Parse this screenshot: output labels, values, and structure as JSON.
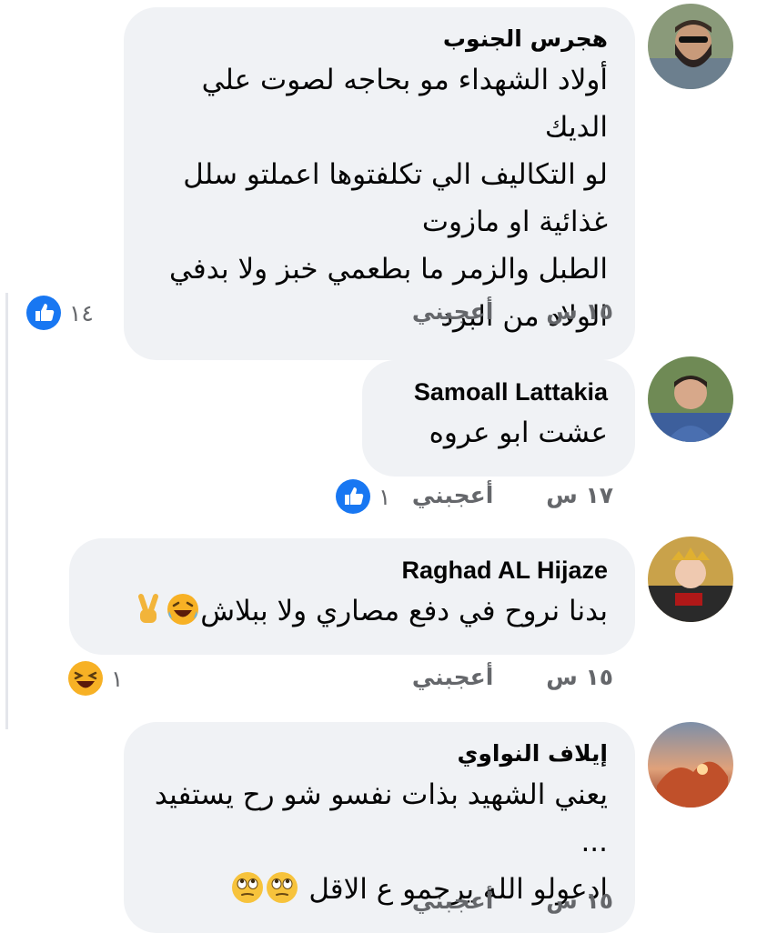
{
  "comments": [
    {
      "author": "هجرس الجنوب",
      "text": "أولاد الشهداء مو بحاجه لصوت علي الديك\nلو التكاليف الي تكلفتوها اعملتو سلل غذائية او مازوت\nالطبل والزمر ما بطعمي خبز ولا بدفي الولاد من البرد",
      "time": "١٥ س",
      "like": "أعجبني",
      "reaction_icon": "like-icon",
      "reaction_count": "١٤"
    },
    {
      "author": "Samoall Lattakia",
      "text": "عشت ابو عروه",
      "time": "١٧ س",
      "like": "أعجبني",
      "reaction_icon": "like-icon",
      "reaction_count": "١"
    },
    {
      "author": "Raghad AL Hijaze",
      "text": "بدنا نروح في دفع مصاري ولا ببلاش",
      "text_emojis": [
        "laughing-tears-emoji",
        "victory-hand-emoji"
      ],
      "time": "١٥ س",
      "like": "أعجبني",
      "reaction_icon": "haha-icon",
      "reaction_count": "١"
    },
    {
      "author": "إيلاف النواوي",
      "text": "يعني الشهيد بذات نفسو شو رح يستفيد ...\nادعولو الله يرحمو ع الاقل",
      "text_emojis": [
        "eye-roll-emoji",
        "eye-roll-emoji"
      ],
      "time": "١٥ س",
      "like": "أعجبني"
    }
  ],
  "colors": {
    "bubble": "#f0f2f5",
    "meta_text": "#65676b",
    "like_blue": "#1877f2",
    "haha_yellow": "#f7b125"
  }
}
